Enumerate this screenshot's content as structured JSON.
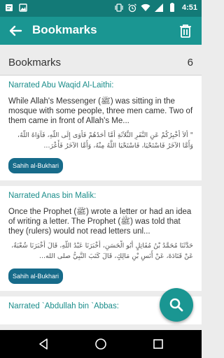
{
  "status": {
    "time": "4:51",
    "left_icons": [
      "notification-icon",
      "photo-icon"
    ],
    "right_icons": [
      "vibrate-icon",
      "alarm-icon",
      "wifi-icon",
      "signal-icon",
      "battery-icon"
    ]
  },
  "appbar": {
    "title": "Bookmarks",
    "back_icon": "arrow-back-icon",
    "delete_icon": "trash-icon",
    "color": "#1a9692"
  },
  "section": {
    "label": "Bookmarks",
    "count": "6"
  },
  "bookmarks": [
    {
      "narrator": "Narrated Abu Waqid Al-Laithi:",
      "english": "While Allah's Messenger (ﷺ) was sitting in the mosque with some people, three men came. Two of them came in front of Allah's Me...",
      "arabic": "\" أَلاَ أُخْبِرُكُمْ عَنِ النَّفَرِ الثَّلاَثَةِ أَمَّا أَحَدُهُمْ فَأَوَى إِلَى اللَّهِ، فَآوَاهُ اللَّهُ، وَأَمَّا الآخَرُ فَاسْتَحْيَا، فَاسْتَحْيَا اللَّهُ مِنْهُ، وَأَمَّا الآخَرُ فَأَعْرَ...",
      "source": "Sahih al-Bukhari"
    },
    {
      "narrator": "Narrated Anas bin Malik:",
      "english": "Once the Prophet (ﷺ) wrote a letter or had an idea of writing a letter. The Prophet (ﷺ) was told that they (rulers) would not read letters unl...",
      "arabic": "حَدَّثَنَا مُحَمَّدُ بْنُ مُقَاتِلٍ أَبُو الْحَسَنِ، أَخْبَرَنَا عَبْدُ اللَّهِ، قَالَ أَخْبَرَنَا شُعْبَةُ، عَنْ قَتَادَةَ، عَنْ أَنَسِ بْنِ مَالِكٍ، قَالَ كَتَبَ النَّبِيُّ صلى الله...",
      "source": "Sahih al-Bukhari"
    },
    {
      "narrator": "Narrated `Abdullah bin `Abbas:",
      "english": "",
      "arabic": "",
      "source": ""
    }
  ],
  "fab": {
    "icon": "search-icon"
  },
  "navbar": {
    "icons": [
      "back-icon",
      "home-icon",
      "recents-icon"
    ]
  }
}
